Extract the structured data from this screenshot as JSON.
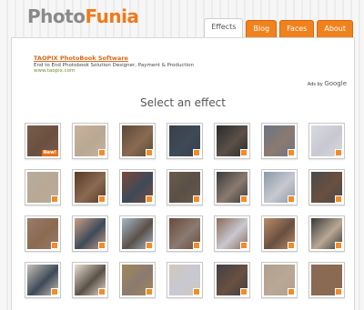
{
  "header": {
    "logo_part1": "Photo",
    "logo_part2": "Funia",
    "tabs": [
      {
        "label": "Effects"
      },
      {
        "label": "Blog"
      },
      {
        "label": "Faces"
      },
      {
        "label": "About"
      }
    ]
  },
  "ad": {
    "title": "TAOPIX PhotoBook Software",
    "description": "End to End Photobook Solution Designer, Payment & Production",
    "url": "www.taopix.com",
    "ads_by_label": "Ads by",
    "ads_by_brand": "Google"
  },
  "main": {
    "heading": "Select an effect",
    "new_badge": "New!"
  },
  "colors": {
    "accent": "#f0821e",
    "tile_tones": [
      "#6a5040",
      "#b8a894",
      "#8a6a50",
      "#3e4a58",
      "#5a5048",
      "#8a7a70",
      "#c8c8d0"
    ]
  }
}
